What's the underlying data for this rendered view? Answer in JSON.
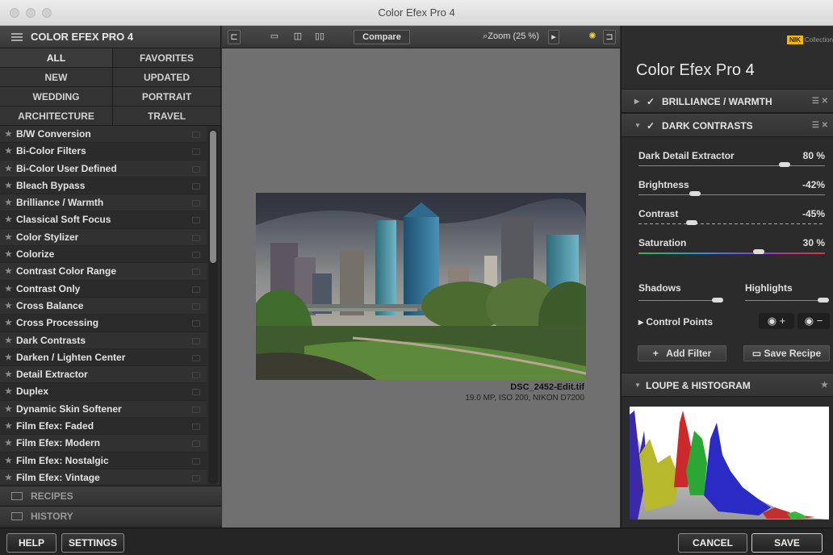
{
  "window": {
    "title": "Color Efex Pro 4"
  },
  "left": {
    "header": "COLOR EFEX PRO 4",
    "categories": [
      "ALL",
      "FAVORITES",
      "NEW",
      "UPDATED",
      "WEDDING",
      "PORTRAIT",
      "ARCHITECTURE",
      "TRAVEL"
    ],
    "filters": [
      "B/W Conversion",
      "Bi-Color Filters",
      "Bi-Color User Defined",
      "Bleach Bypass",
      "Brilliance / Warmth",
      "Classical Soft Focus",
      "Color Stylizer",
      "Colorize",
      "Contrast Color Range",
      "Contrast Only",
      "Cross Balance",
      "Cross Processing",
      "Dark Contrasts",
      "Darken / Lighten Center",
      "Detail Extractor",
      "Duplex",
      "Dynamic Skin Softener",
      "Film Efex: Faded",
      "Film Efex: Modern",
      "Film Efex: Nostalgic",
      "Film Efex: Vintage"
    ],
    "recipes_label": "RECIPES",
    "history_label": "HISTORY"
  },
  "toolbar": {
    "compare_label": "Compare",
    "zoom_label": "Zoom (25 %)"
  },
  "photo": {
    "filename": "DSC_2452-Edit.tif",
    "info": "19.0 MP, ISO 200, NIKON D7200"
  },
  "right": {
    "logo": "NIK",
    "logo_suffix": "Collection",
    "title": "Color Efex Pro",
    "title_num": "4",
    "filter1": "BRILLIANCE / WARMTH",
    "filter2": "DARK CONTRASTS",
    "sliders": [
      {
        "name": "Dark Detail Extractor",
        "value": "80 %",
        "level": 0.8
      },
      {
        "name": "Brightness",
        "value": "-42%",
        "level": 0.29
      },
      {
        "name": "Contrast",
        "value": "-45%",
        "level": 0.27
      },
      {
        "name": "Saturation",
        "value": "30 %",
        "level": 0.65
      }
    ],
    "shadows_label": "Shadows",
    "highlights_label": "Highlights",
    "control_points": "Control Points",
    "add_filter": "Add Filter",
    "save_recipe": "Save Recipe",
    "loupe": "LOUPE & HISTOGRAM"
  },
  "bottom": {
    "help": "HELP",
    "settings": "SETTINGS",
    "cancel": "CANCEL",
    "save": "SAVE"
  }
}
